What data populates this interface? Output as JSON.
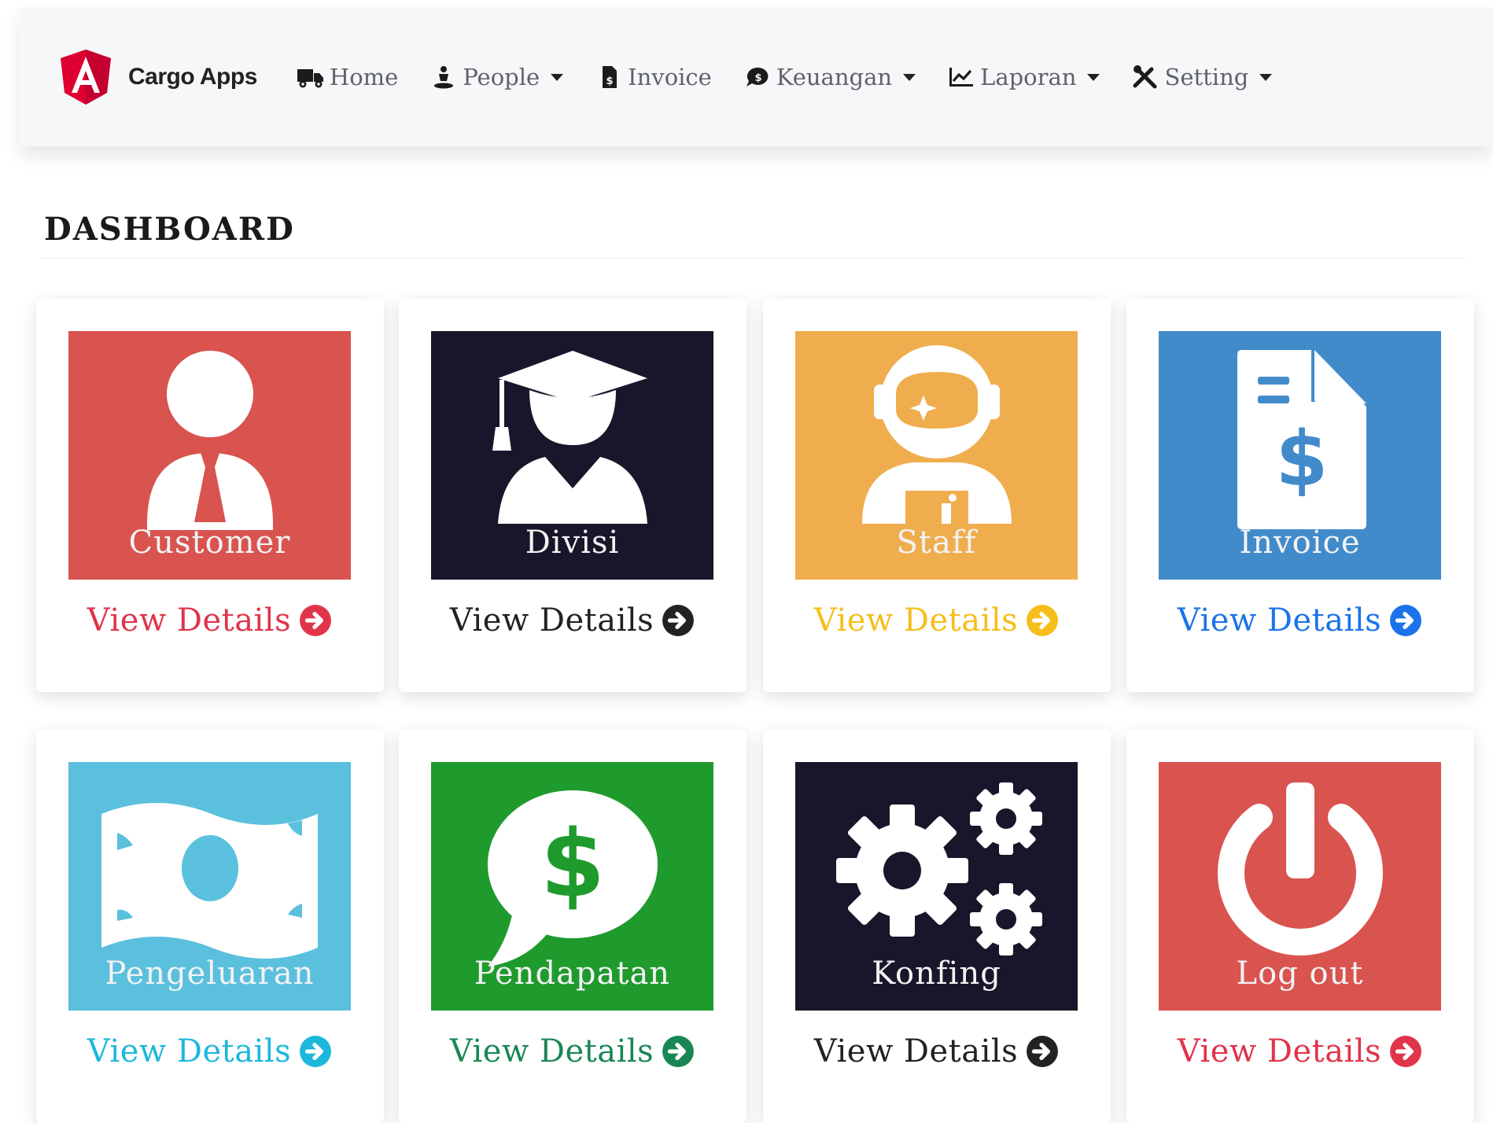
{
  "brand": {
    "name": "Cargo Apps",
    "logo_icon": "angular-shield-logo",
    "logo_color": "#dd0031"
  },
  "nav": [
    {
      "label": "Home",
      "icon": "truck-icon",
      "dropdown": false
    },
    {
      "label": "People",
      "icon": "person-icon",
      "dropdown": true
    },
    {
      "label": "Invoice",
      "icon": "invoice-file-icon",
      "dropdown": false
    },
    {
      "label": "Keuangan",
      "icon": "money-bubble-icon",
      "dropdown": true
    },
    {
      "label": "Laporan",
      "icon": "chart-line-icon",
      "dropdown": true
    },
    {
      "label": "Setting",
      "icon": "tools-icon",
      "dropdown": true
    }
  ],
  "page": {
    "title": "DASHBOARD"
  },
  "cards": [
    {
      "label": "Customer",
      "icon": "user-tie-icon",
      "bg": "#d9534f",
      "accent": "#e0344a",
      "details": "View Details"
    },
    {
      "label": "Divisi",
      "icon": "graduate-icon",
      "bg": "#18162a",
      "accent": "#222222",
      "details": "View Details"
    },
    {
      "label": "Staff",
      "icon": "astronaut-icon",
      "bg": "#f0ad4e",
      "accent": "#f6be1a",
      "details": "View Details"
    },
    {
      "label": "Invoice",
      "icon": "invoice-dollar-icon",
      "bg": "#428bca",
      "accent": "#1a73e8",
      "details": "View Details"
    },
    {
      "label": "Pengeluaran",
      "icon": "money-bill-icon",
      "bg": "#5bc0de",
      "accent": "#1cb8dc",
      "details": "View Details"
    },
    {
      "label": "Pendapatan",
      "icon": "comment-dollar-icon",
      "bg": "#1f9a2d",
      "accent": "#198754",
      "details": "View Details"
    },
    {
      "label": "Konfing",
      "icon": "cogs-icon",
      "bg": "#18162a",
      "accent": "#222222",
      "details": "View Details"
    },
    {
      "label": "Log out",
      "icon": "power-icon",
      "bg": "#d9534f",
      "accent": "#e0344a",
      "details": "View Details"
    }
  ]
}
